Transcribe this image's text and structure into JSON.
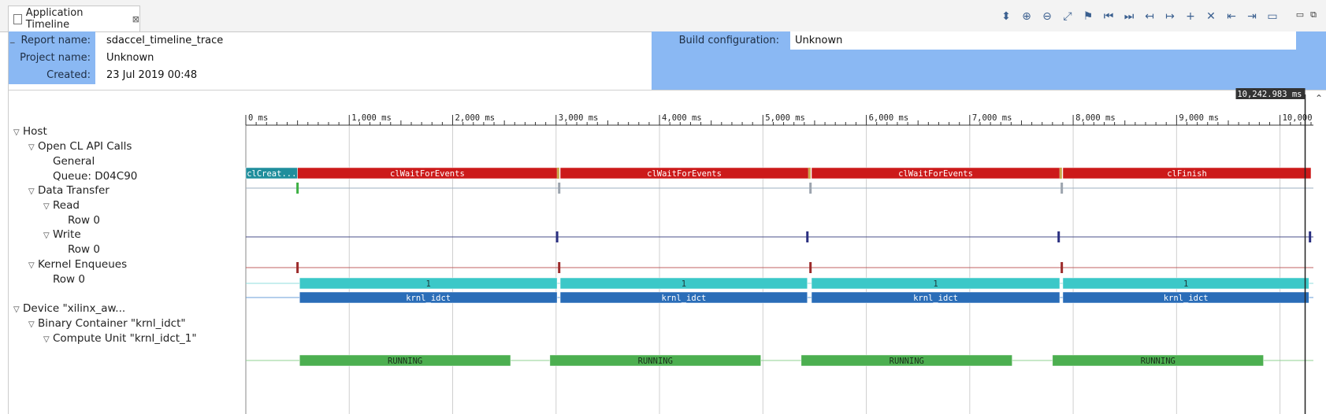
{
  "tab": {
    "title": "Application Timeline",
    "close": "⊠"
  },
  "toolbar": [
    "updown-arrows-icon",
    "zoom-in-icon",
    "zoom-out-icon",
    "zoom-fit-icon",
    "marker-icon",
    "first-icon",
    "last-icon",
    "prev-event-icon",
    "next-event-icon",
    "add-marker-icon",
    "remove-marker-icon",
    "go-marker-prev-icon",
    "go-marker-next-icon",
    "ruler-icon"
  ],
  "window_controls": [
    "▭",
    "⧉"
  ],
  "report": {
    "report_name_label": "Report name:",
    "report_name": "sdaccel_timeline_trace",
    "project_name_label": "Project name:",
    "project_name": "Unknown",
    "created_label": "Created:",
    "created": "23 Jul 2019 00:48",
    "build_config_label": "Build configuration:",
    "build_config": "Unknown",
    "collapse": "_"
  },
  "cursor_time": "10,242.983 ms",
  "axis": {
    "min": 0,
    "max": 10300,
    "ticks": [
      {
        "v": 0,
        "label": "0 ms"
      },
      {
        "v": 1000,
        "label": "1,000 ms"
      },
      {
        "v": 2000,
        "label": "2,000 ms"
      },
      {
        "v": 3000,
        "label": "3,000 ms"
      },
      {
        "v": 4000,
        "label": "4,000 ms"
      },
      {
        "v": 5000,
        "label": "5,000 ms"
      },
      {
        "v": 6000,
        "label": "6,000 ms"
      },
      {
        "v": 7000,
        "label": "7,000 ms"
      },
      {
        "v": 8000,
        "label": "8,000 ms"
      },
      {
        "v": 9000,
        "label": "9,000 ms"
      },
      {
        "v": 10000,
        "label": "10,000"
      }
    ]
  },
  "tree": [
    {
      "label": "Host",
      "level": 0,
      "expanded": true
    },
    {
      "label": "Open CL API Calls",
      "level": 1,
      "expanded": true
    },
    {
      "label": "General",
      "level": 2
    },
    {
      "label": "Queue: D04C90",
      "level": 2
    },
    {
      "label": "Data Transfer",
      "level": 1,
      "expanded": true
    },
    {
      "label": "Read",
      "level": 2,
      "expanded": true
    },
    {
      "label": "Row 0",
      "level": 3
    },
    {
      "label": "Write",
      "level": 2,
      "expanded": true
    },
    {
      "label": "Row 0",
      "level": 3
    },
    {
      "label": "Kernel Enqueues",
      "level": 1,
      "expanded": true
    },
    {
      "label": "Row 0",
      "level": 2
    },
    {
      "label": "",
      "level": 0
    },
    {
      "label": "Device \"xilinx_aw...",
      "level": 0,
      "expanded": true
    },
    {
      "label": "Binary Container \"krnl_idct\"",
      "level": 1,
      "expanded": true
    },
    {
      "label": "Compute Unit \"krnl_idct_1\"",
      "level": 2,
      "expanded": true
    }
  ],
  "chart_data": {
    "type": "timeline",
    "units": "ms",
    "rows": [
      {
        "row": "General",
        "color": "#cc1a1a",
        "events": [
          {
            "start": 0,
            "end": 500,
            "label": "clCreat...",
            "color": "#1f8e9c"
          },
          {
            "start": 500,
            "end": 3010,
            "label": "clWaitForEvents"
          },
          {
            "start": 3040,
            "end": 5440,
            "label": "clWaitForEvents"
          },
          {
            "start": 5470,
            "end": 7870,
            "label": "clWaitForEvents"
          },
          {
            "start": 7900,
            "end": 10300,
            "label": "clFinish"
          }
        ],
        "ticks": [
          3020,
          5450,
          7880
        ],
        "tick_color": "#c9a74a"
      },
      {
        "row": "Queue: D04C90",
        "line_color": "#9eb0c2",
        "ticks": [
          {
            "v": 500,
            "color": "#3cb043"
          },
          {
            "v": 3030,
            "color": "#9ca4ae"
          },
          {
            "v": 5460,
            "color": "#9ca4ae"
          },
          {
            "v": 7890,
            "color": "#9ca4ae"
          }
        ]
      },
      {
        "row": "Read Row 0",
        "line_color": "#4a4f8a",
        "ticks": [
          {
            "v": 3010,
            "color": "#2a2f80"
          },
          {
            "v": 5430,
            "color": "#2a2f80"
          },
          {
            "v": 7860,
            "color": "#2a2f80"
          },
          {
            "v": 10290,
            "color": "#2a2f80"
          }
        ]
      },
      {
        "row": "Write Row 0",
        "line_color": "#c06060",
        "ticks": [
          {
            "v": 500,
            "color": "#9c2a2a"
          },
          {
            "v": 3030,
            "color": "#9c2a2a"
          },
          {
            "v": 5460,
            "color": "#9c2a2a"
          },
          {
            "v": 7890,
            "color": "#9c2a2a"
          }
        ]
      },
      {
        "row": "Kernel Enqueues",
        "color": "#3cc8c8",
        "text_color": "#1e3a3a",
        "line_color": "#8fdcdc",
        "events": [
          {
            "start": 520,
            "end": 3010,
            "label": "1"
          },
          {
            "start": 3040,
            "end": 5430,
            "label": "1"
          },
          {
            "start": 5470,
            "end": 7870,
            "label": "1"
          },
          {
            "start": 7900,
            "end": 10280,
            "label": "1"
          }
        ]
      },
      {
        "row": "Kernel Enqueues Row 0",
        "color": "#2a6db8",
        "line_color": "#6a9fd8",
        "events": [
          {
            "start": 520,
            "end": 3010,
            "label": "krnl_idct"
          },
          {
            "start": 3040,
            "end": 5430,
            "label": "krnl_idct"
          },
          {
            "start": 5470,
            "end": 7870,
            "label": "krnl_idct"
          },
          {
            "start": 7900,
            "end": 10280,
            "label": "krnl_idct"
          }
        ]
      },
      {
        "row": "Compute Unit",
        "color": "#4caf50",
        "text_color": "#1a2e1a",
        "line_color": "#8fd092",
        "events": [
          {
            "start": 520,
            "end": 2560,
            "label": "RUNNING"
          },
          {
            "start": 2940,
            "end": 4980,
            "label": "RUNNING"
          },
          {
            "start": 5370,
            "end": 7410,
            "label": "RUNNING"
          },
          {
            "start": 7800,
            "end": 9840,
            "label": "RUNNING"
          }
        ]
      }
    ],
    "cursor_ms": 10242.983
  }
}
